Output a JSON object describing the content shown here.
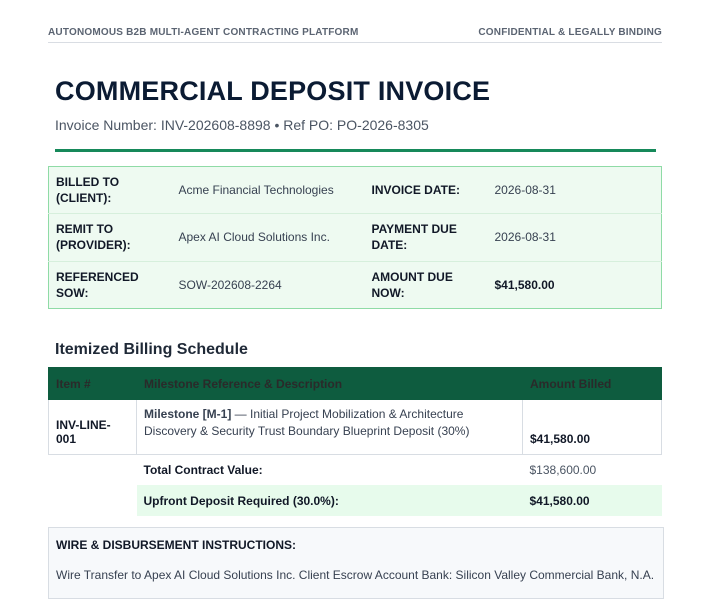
{
  "header": {
    "platform": "AUTONOMOUS B2B MULTI-AGENT CONTRACTING PLATFORM",
    "confidentiality": "CONFIDENTIAL & LEGALLY BINDING"
  },
  "document": {
    "title": "COMMERCIAL DEPOSIT INVOICE",
    "subtitle": "Invoice Number: INV-202608-8898 • Ref PO: PO-2026-8305"
  },
  "meta": {
    "billed_to_label": "BILLED TO (CLIENT):",
    "billed_to": "Acme Financial Technologies",
    "invoice_date_label": "INVOICE DATE:",
    "invoice_date": "2026-08-31",
    "remit_to_label": "REMIT TO (PROVIDER):",
    "remit_to": "Apex AI Cloud Solutions Inc.",
    "due_date_label": "PAYMENT DUE DATE:",
    "due_date": "2026-08-31",
    "sow_label": "REFERENCED SOW:",
    "sow": "SOW-202608-2264",
    "amount_due_label": "AMOUNT DUE NOW:",
    "amount_due": "$41,580.00"
  },
  "schedule": {
    "heading": "Itemized Billing Schedule",
    "columns": [
      "Item #",
      "Milestone Reference & Description",
      "Amount Billed"
    ],
    "rows": [
      {
        "item": "INV-LINE-001",
        "milestone": "Milestone [M-1]",
        "description": " — Initial Project Mobilization & Architecture Discovery & Security Trust Boundary Blueprint Deposit (30%)",
        "amount": "$41,580.00"
      }
    ],
    "total_label": "Total Contract Value:",
    "total_value": "$138,600.00",
    "deposit_label": "Upfront Deposit Required (30.0%):",
    "deposit_value": "$41,580.00"
  },
  "wire": {
    "heading": "WIRE & DISBURSEMENT INSTRUCTIONS:",
    "text": "Wire Transfer to Apex AI Cloud Solutions Inc. Client Escrow Account Bank: Silicon Valley Commercial Bank, N.A."
  },
  "colors": {
    "accent": "#16895a",
    "table_header": "#0e5c3f",
    "meta_bg": "#eefaf1",
    "deposit_bg": "#e7fbec"
  }
}
